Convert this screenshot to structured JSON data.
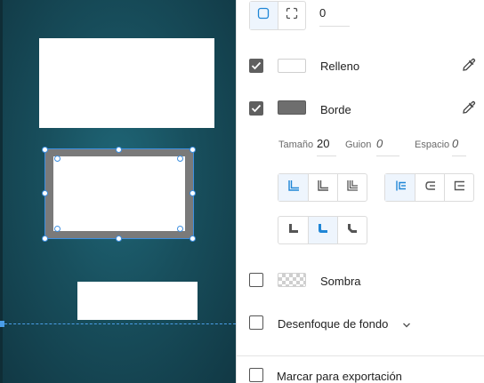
{
  "corner": {
    "radius_value": "0",
    "modes": [
      {
        "name": "uniform-corner-icon",
        "active": true
      },
      {
        "name": "independent-corners-icon",
        "active": false
      }
    ]
  },
  "fill": {
    "label": "Relleno",
    "checked": true,
    "color": "#ffffff"
  },
  "border": {
    "label": "Borde",
    "checked": true,
    "color": "#6e6e6e",
    "size_label": "Tamaño",
    "size_value": "20",
    "dash_label": "Guion",
    "dash_value": "0",
    "gap_label": "Espacio",
    "gap_value": "0"
  },
  "shadow": {
    "label": "Sombra",
    "checked": false
  },
  "blur": {
    "label": "Desenfoque de fondo",
    "checked": false
  },
  "export": {
    "label": "Marcar para exportación",
    "checked": false
  },
  "accent_color": "#1f86d6"
}
